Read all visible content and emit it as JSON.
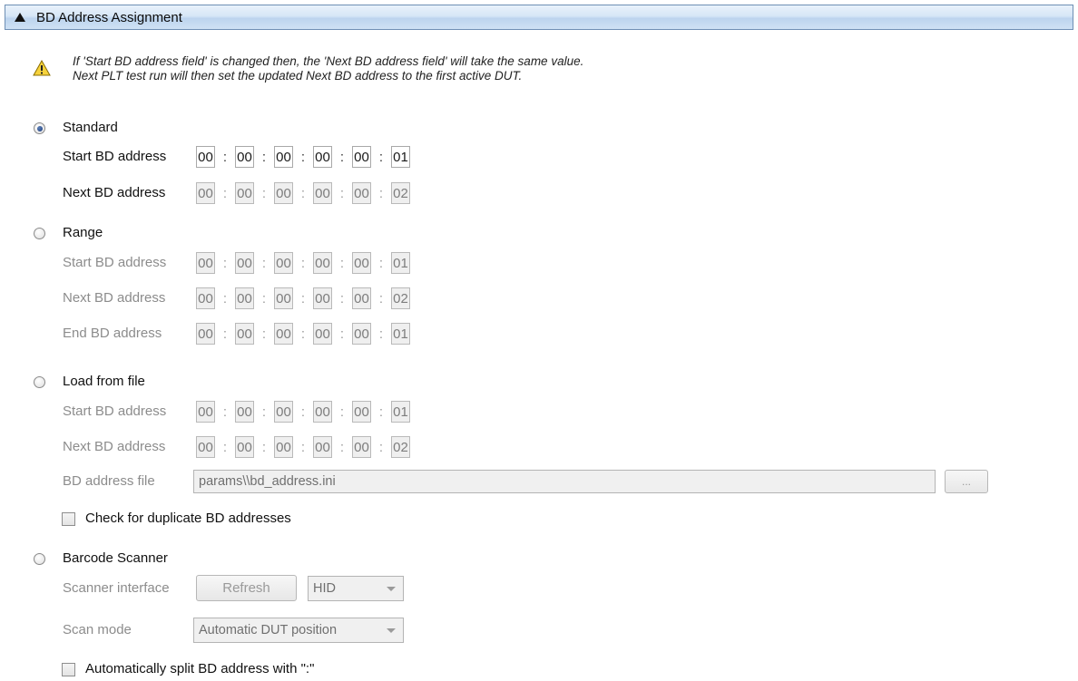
{
  "header": {
    "title": "BD Address Assignment"
  },
  "warning": {
    "line1": "If 'Start BD address field' is changed then, the 'Next BD address field' will take the same value.",
    "line2": "Next PLT test run will then set the updated Next BD address to the first active DUT."
  },
  "standard": {
    "label": "Standard",
    "selected": true,
    "start_label": "Start BD address",
    "start": [
      "00",
      "00",
      "00",
      "00",
      "00",
      "01"
    ],
    "next_label": "Next BD address",
    "next": [
      "00",
      "00",
      "00",
      "00",
      "00",
      "02"
    ]
  },
  "range": {
    "label": "Range",
    "selected": false,
    "start_label": "Start BD address",
    "start": [
      "00",
      "00",
      "00",
      "00",
      "00",
      "01"
    ],
    "next_label": "Next BD address",
    "next": [
      "00",
      "00",
      "00",
      "00",
      "00",
      "02"
    ],
    "end_label": "End BD address",
    "end": [
      "00",
      "00",
      "00",
      "00",
      "00",
      "01"
    ]
  },
  "load_from_file": {
    "label": "Load from file",
    "selected": false,
    "start_label": "Start BD address",
    "start": [
      "00",
      "00",
      "00",
      "00",
      "00",
      "01"
    ],
    "next_label": "Next BD address",
    "next": [
      "00",
      "00",
      "00",
      "00",
      "00",
      "02"
    ],
    "file_label": "BD address file",
    "file_value": "params\\\\bd_address.ini",
    "browse_label": "...",
    "dup_check_label": "Check for duplicate BD addresses",
    "dup_check_checked": false
  },
  "barcode": {
    "label": "Barcode Scanner",
    "selected": false,
    "interface_label": "Scanner interface",
    "refresh_label": "Refresh",
    "interface_value": "HID",
    "scan_mode_label": "Scan mode",
    "scan_mode_value": "Automatic DUT position",
    "split_label": "Automatically split BD address with \":\"",
    "split_checked": false
  }
}
